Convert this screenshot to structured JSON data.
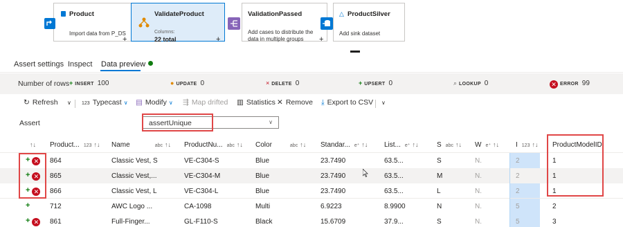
{
  "flow": {
    "nodes": [
      {
        "title": "Product",
        "desc": "Import data from P_DS",
        "icon": "source-icon"
      },
      {
        "title": "ValidateProduct",
        "sub_label": "Columns:",
        "sub_value": "22 total",
        "icon": "assert-icon"
      },
      {
        "title": "ValidationPassed",
        "desc": "Add cases to distribute the data in multiple groups",
        "icon": "split-icon"
      },
      {
        "title": "ProductSilver",
        "desc": "Add sink dataset",
        "icon": "sink-icon"
      }
    ],
    "plus": "+"
  },
  "tabs": {
    "items": [
      "Assert settings",
      "Inspect",
      "Data preview"
    ],
    "active": "Data preview"
  },
  "stats": {
    "rows_label": "Number of rows",
    "insert": {
      "label": "INSERT",
      "value": "100"
    },
    "update": {
      "label": "UPDATE",
      "value": "0"
    },
    "delete": {
      "label": "DELETE",
      "value": "0"
    },
    "upsert": {
      "label": "UPSERT",
      "value": "0"
    },
    "lookup": {
      "label": "LOOKUP",
      "value": "0"
    },
    "error": {
      "label": "ERROR",
      "value": "99"
    }
  },
  "toolbar": {
    "refresh": "Refresh",
    "typecast": "Typecast",
    "typecast_prefix": "123",
    "modify": "Modify",
    "map_drifted": "Map drifted",
    "statistics": "Statistics",
    "remove": "Remove",
    "export": "Export to CSV"
  },
  "assert": {
    "label": "Assert",
    "selected": "assertUnique"
  },
  "table": {
    "columns": [
      {
        "name": "Product...",
        "type": "123"
      },
      {
        "name": "Name",
        "type": "abc"
      },
      {
        "name": "ProductNu...",
        "type": "abc"
      },
      {
        "name": "Color",
        "type": "abc"
      },
      {
        "name": "Standar...",
        "type": "e⁺"
      },
      {
        "name": "List...",
        "type": "e⁺"
      },
      {
        "name": "S",
        "type": "abc"
      },
      {
        "name": "W",
        "type": "e⁺"
      },
      {
        "name": "I",
        "type": "123"
      },
      {
        "name": "ProductModelID",
        "type": ""
      }
    ],
    "rows": [
      {
        "error": true,
        "product": "864",
        "name": "Classic Vest, S",
        "number": "VE-C304-S",
        "color": "Blue",
        "standard": "23.7490",
        "list": "63.5...",
        "s": "S",
        "w": "N.",
        "i": "2",
        "model": "1"
      },
      {
        "error": true,
        "product": "865",
        "name": "Classic Vest,...",
        "number": "VE-C304-M",
        "color": "Blue",
        "standard": "23.7490",
        "list": "63.5...",
        "s": "M",
        "w": "N.",
        "i": "2",
        "model": "1"
      },
      {
        "error": true,
        "product": "866",
        "name": "Classic Vest, L",
        "number": "VE-C304-L",
        "color": "Blue",
        "standard": "23.7490",
        "list": "63.5...",
        "s": "L",
        "w": "N.",
        "i": "2",
        "model": "1"
      },
      {
        "error": false,
        "product": "712",
        "name": "AWC Logo ...",
        "number": "CA-1098",
        "color": "Multi",
        "standard": "6.9223",
        "list": "8.9900",
        "s": "N",
        "w": "N.",
        "i": "5",
        "model": "2"
      },
      {
        "error": true,
        "product": "861",
        "name": "Full-Finger...",
        "number": "GL-F110-S",
        "color": "Black",
        "standard": "15.6709",
        "list": "37.9...",
        "s": "S",
        "w": "N.",
        "i": "5",
        "model": "3"
      }
    ]
  }
}
